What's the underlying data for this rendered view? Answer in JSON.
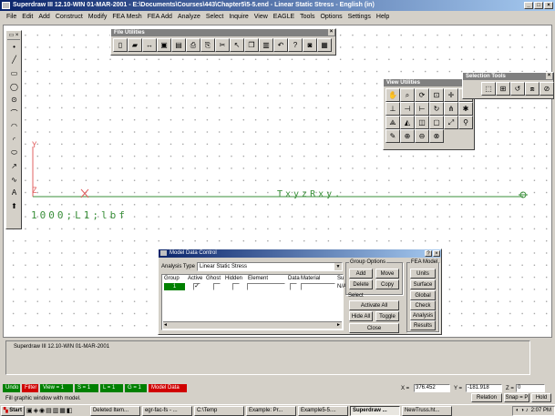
{
  "window": {
    "title": "Superdraw III 12.10-WIN 01-MAR-2001 - E:\\Documents\\Courses\\443\\Chapter5\\5-5.end - Linear Static Stress - English (in)"
  },
  "menu": [
    "File",
    "Edit",
    "Add",
    "Construct",
    "Modify",
    "FEA Mesh",
    "FEA Add",
    "Analyze",
    "Select",
    "Inquire",
    "View",
    "EAGLE",
    "Tools",
    "Options",
    "Settings",
    "Help"
  ],
  "canvas": {
    "axis_y_label": "Y",
    "axis_z_label": "Z",
    "axis_x_label": "X",
    "constraint_text": "TxyzRxy.",
    "load_text": "1000;L1;lbf",
    "colors": {
      "geometry": "#3a8f3a",
      "axis": "#e06060"
    }
  },
  "file_utilities": {
    "title": "File Utilities",
    "icons": [
      "new-icon",
      "open-icon",
      "exchange-icon",
      "save-icon",
      "save-as-icon",
      "print-icon",
      "print-setup-icon",
      "cut-icon",
      "arrow-icon",
      "copy-icon",
      "paste-icon",
      "undo-icon",
      "help-icon",
      "camera-icon",
      "clip-icon"
    ]
  },
  "view_utilities": {
    "title": "View Utilities",
    "icons": [
      "pan-icon",
      "zoom-icon",
      "rotate-icon",
      "zoom-window-icon",
      "center-icon",
      "sphere-icon",
      "view-xy-icon",
      "view-yz-icon",
      "view-xz-icon",
      "rotate-free-icon",
      "axes-icon",
      "spin-icon",
      "view-iso-icon",
      "view-3d-icon",
      "view-dim-icon",
      "box-icon",
      "fit-icon",
      "measure-icon",
      "draw-icon",
      "zoom-in-icon",
      "zoom-out-icon",
      "zoom-all-icon"
    ]
  },
  "selection_tools": {
    "title": "Selection Tools",
    "icons": [
      "select-icon",
      "select-add-icon",
      "select-cycle-icon",
      "select-all-icon",
      "deselect-icon"
    ]
  },
  "left_toolbar": {
    "icons": [
      "point-icon",
      "line-icon",
      "rectangle-icon",
      "circle-icon",
      "circle-center-icon",
      "arc-icon",
      "arc-3pt-icon",
      "arc-tangent-icon",
      "ellipse-icon",
      "fillet-icon",
      "spline-icon",
      "text-icon",
      "up-arrow-icon"
    ]
  },
  "model_data_control": {
    "title": "Model Data Control",
    "analysis_type_label": "Analysis Type",
    "analysis_type_value": "Linear Static Stress",
    "columns": [
      "Group",
      "Active",
      "Ghost",
      "Hidden",
      "Element",
      "Data",
      "Material",
      "Su"
    ],
    "row": {
      "group": "1",
      "su": "N/A"
    },
    "group_options_label": "Group Options",
    "select_label": "Select",
    "fea_model_label": "FEA Model",
    "buttons": {
      "add": "Add",
      "move": "Move",
      "delete": "Delete",
      "copy": "Copy",
      "activate_all": "Activate All",
      "hide_all": "Hide All",
      "toggle": "Toggle",
      "close": "Close",
      "units": "Units",
      "surface": "Surface",
      "global": "Global",
      "check": "Check",
      "analysis": "Analysis",
      "results": "Results"
    },
    "help": "?",
    "close_x": "×"
  },
  "status_area": {
    "text": "Superdraw III 12.10-WIN 01-MAR-2001"
  },
  "status_bar": {
    "buttons": [
      {
        "label": "Undo",
        "color": "#008000"
      },
      {
        "label": "Filter",
        "color": "#d00000"
      },
      {
        "label": "View = 1",
        "color": "#008000"
      },
      {
        "label": "S = 1",
        "color": "#008000"
      },
      {
        "label": "L = 1",
        "color": "#008000"
      },
      {
        "label": "G = 1",
        "color": "#008000"
      },
      {
        "label": "Model Data",
        "color": "#d00000"
      }
    ],
    "x_label": "X =",
    "x_value": "376.452",
    "y_label": "Y =",
    "y_value": "-181.918",
    "z_label": "Z =",
    "z_value": "0",
    "relation": "Relation",
    "snap": "Snap = P",
    "hold": "Hold",
    "hint": "Fill graphic window with model."
  },
  "taskbar": {
    "start": "Start",
    "items": [
      "Deleted Item...",
      "egr-fac-fs - ...",
      "C:\\Temp",
      "Example: Pr...",
      "Example5-5....",
      "Superdraw ...",
      "NewTruss.ht..."
    ],
    "active_index": 5,
    "clock": "2:07 PM"
  }
}
